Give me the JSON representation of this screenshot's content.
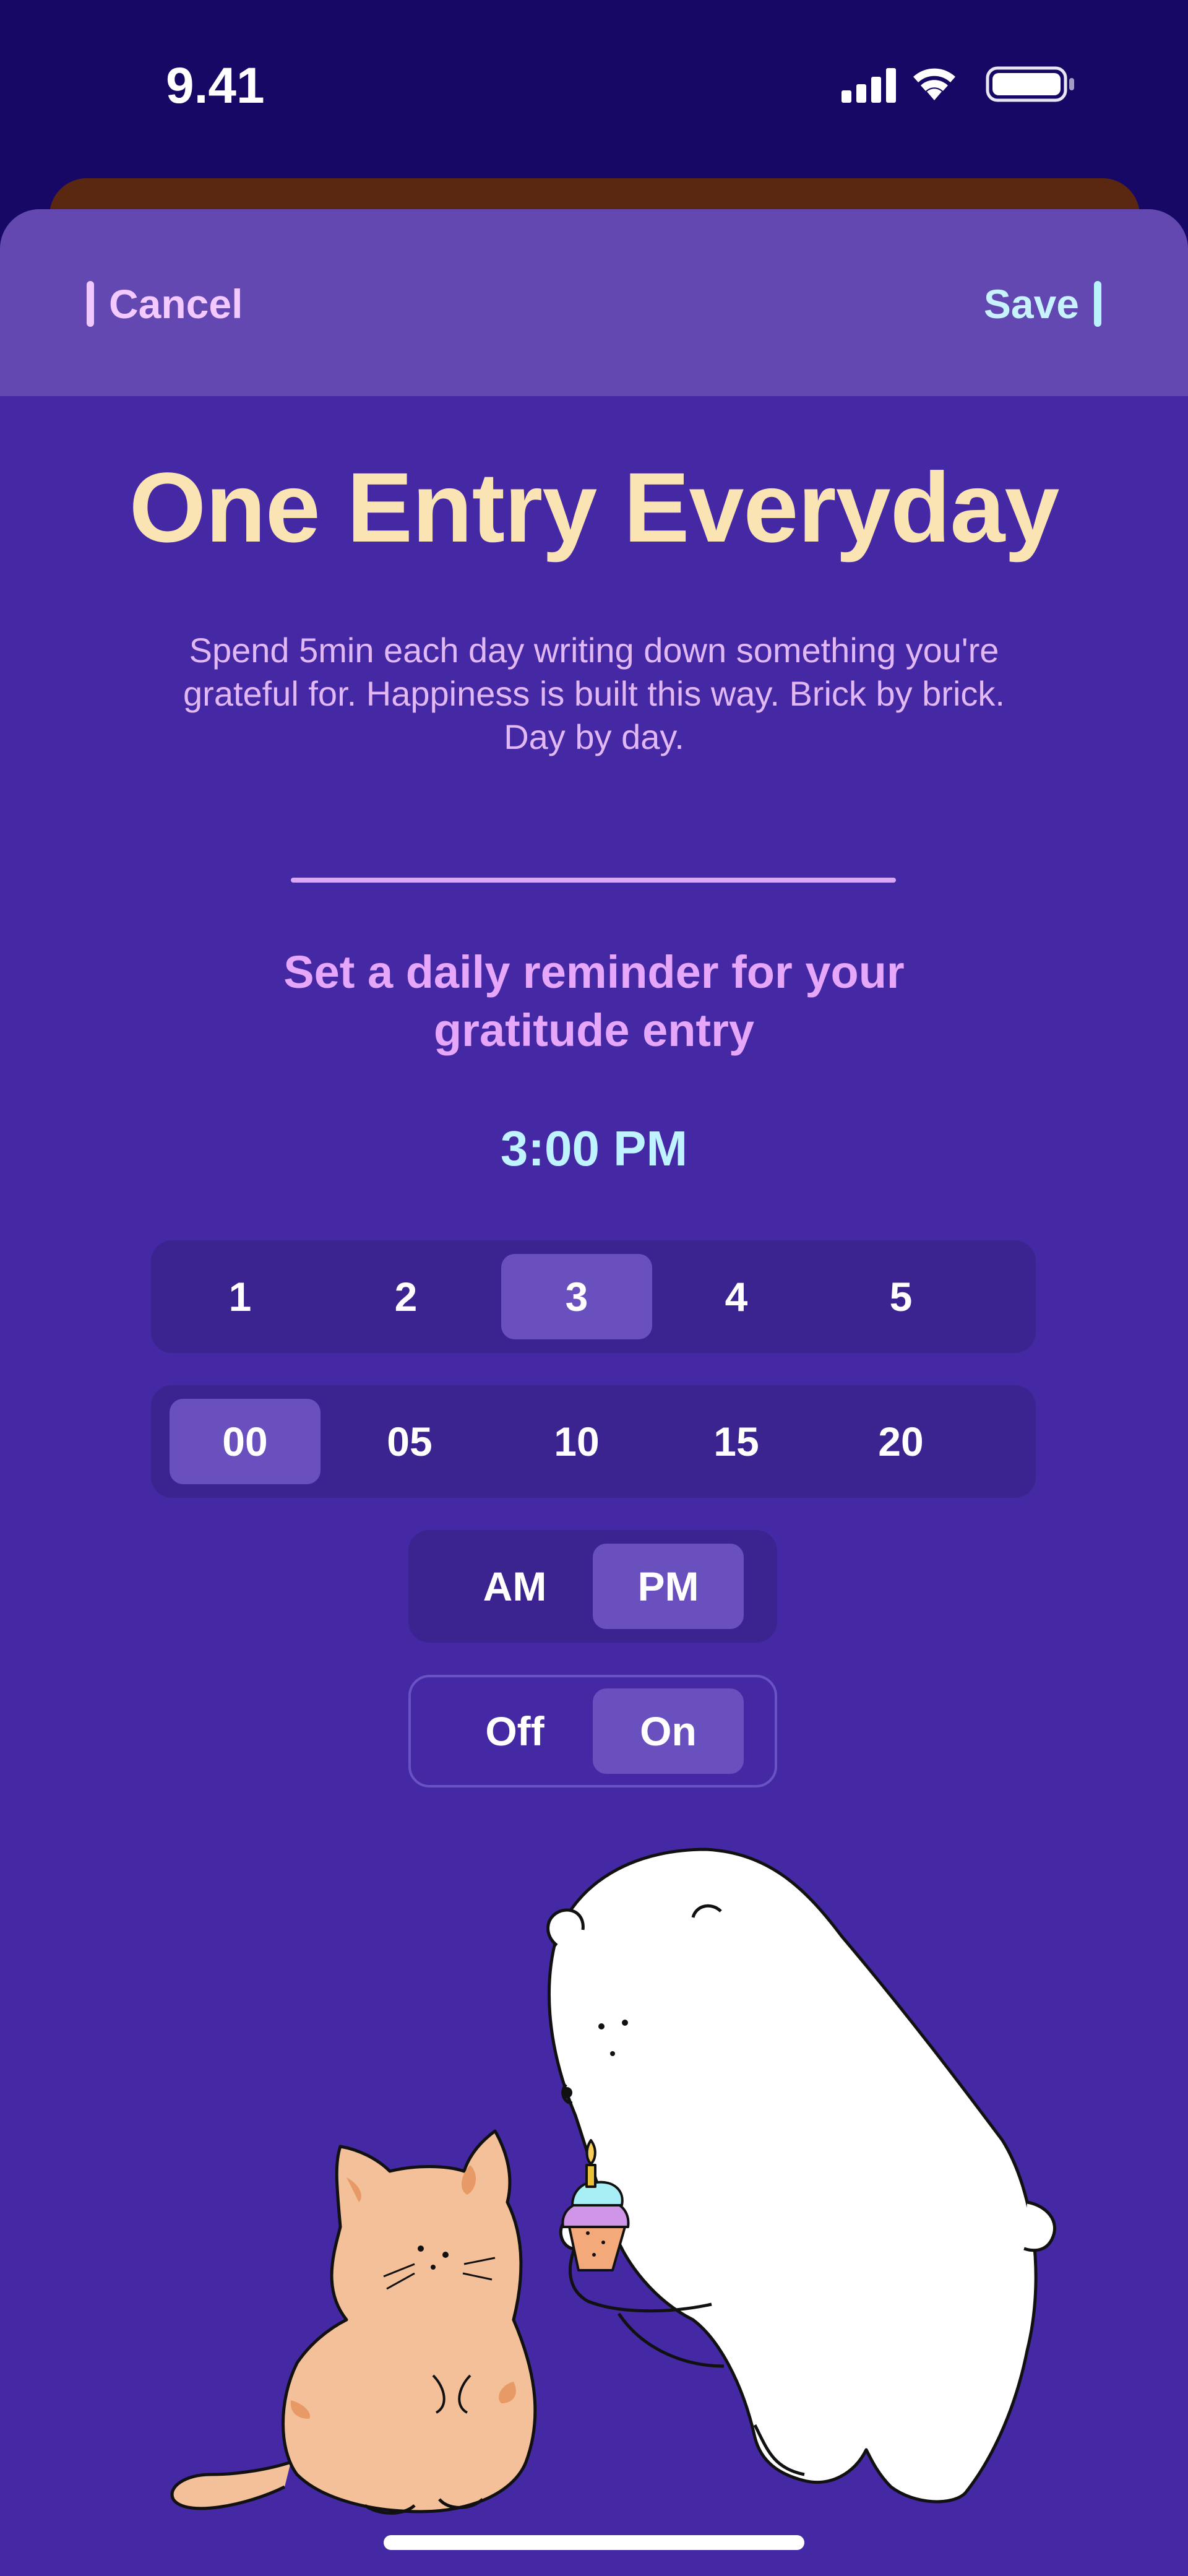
{
  "status_bar": {
    "time": "9.41"
  },
  "header": {
    "cancel_label": "Cancel",
    "save_label": "Save"
  },
  "content": {
    "title": "One Entry Everyday",
    "description": "Spend 5min each day writing down something you're grateful for. Happiness is built this way. Brick by brick. Day by day.",
    "reminder_prompt": "Set a daily reminder for your gratitude entry",
    "selected_time": "3:00 PM"
  },
  "hour_picker": {
    "items": [
      "1",
      "2",
      "3",
      "4",
      "5"
    ],
    "selected": "3"
  },
  "minute_picker": {
    "items": [
      "00",
      "05",
      "10",
      "15",
      "20"
    ],
    "selected": "00"
  },
  "ampm": {
    "options": [
      "AM",
      "PM"
    ],
    "selected": "PM"
  },
  "toggle": {
    "options": [
      "Off",
      "On"
    ],
    "selected": "On"
  },
  "colors": {
    "background": "#170866",
    "sheet": "#4528a4",
    "header": "#6248b0",
    "title": "#fbe4b4",
    "accent_cyan": "#bff3ff",
    "accent_pink": "#e6a6f9",
    "selected_chip": "#6a4fbf"
  },
  "icons": [
    "cellular-signal-icon",
    "wifi-icon",
    "battery-icon"
  ],
  "illustration": {
    "subjects": [
      "cat",
      "polar-bear",
      "cupcake-with-candle"
    ]
  }
}
